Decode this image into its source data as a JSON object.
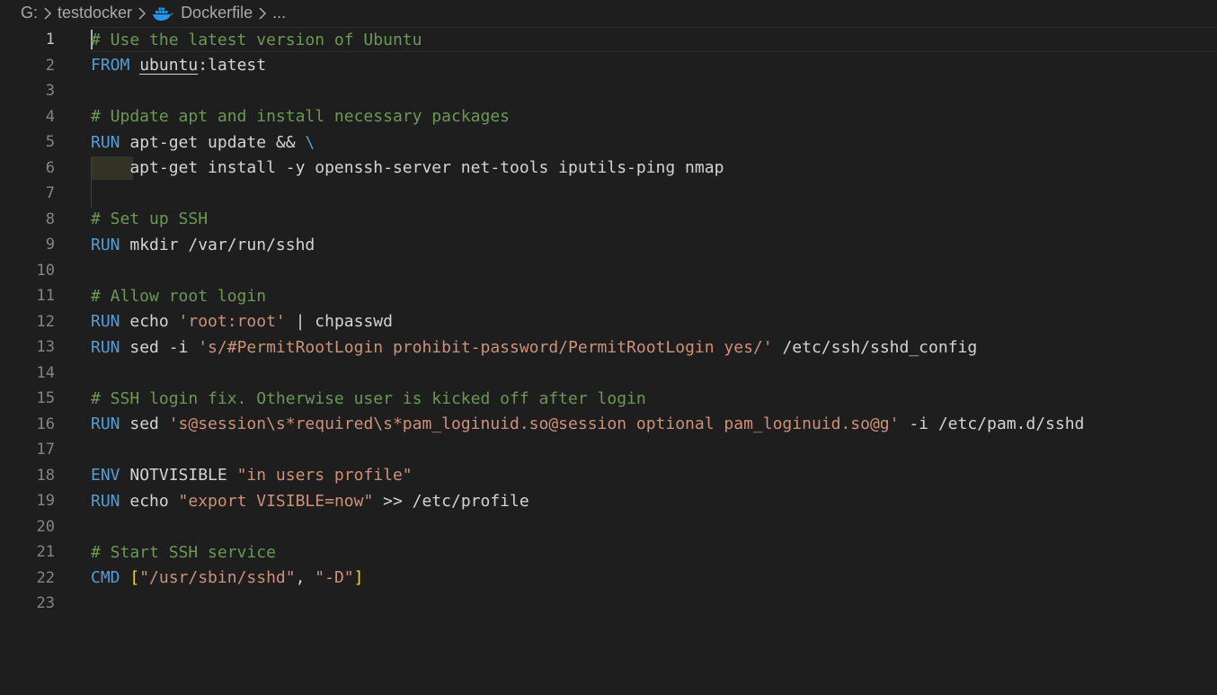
{
  "breadcrumb": {
    "items": [
      {
        "label": "G:",
        "icon": ""
      },
      {
        "label": "testdocker",
        "icon": ""
      },
      {
        "label": "Dockerfile",
        "icon": "docker-whale-icon"
      },
      {
        "label": "...",
        "icon": ""
      }
    ],
    "separator_icon": "chevron-right-icon"
  },
  "colors": {
    "background": "#1e1e1e",
    "comment": "#6a9955",
    "keyword": "#569cd6",
    "string": "#ce9178",
    "text": "#d4d4d4",
    "bracket": "#ffd700",
    "line_number": "#858585",
    "docker": "#2496ed"
  },
  "editor": {
    "active_line": 1,
    "lines": [
      {
        "n": "1",
        "tokens": [
          [
            "c-comment",
            "# Use the latest version of Ubuntu"
          ]
        ]
      },
      {
        "n": "2",
        "tokens": [
          [
            "c-kw",
            "FROM"
          ],
          [
            "c-plain",
            " "
          ],
          [
            "c-plain c-link",
            "ubuntu"
          ],
          [
            "c-plain",
            ":latest"
          ]
        ]
      },
      {
        "n": "3",
        "tokens": []
      },
      {
        "n": "4",
        "tokens": [
          [
            "c-comment",
            "# Update apt and install necessary packages"
          ]
        ]
      },
      {
        "n": "5",
        "tokens": [
          [
            "c-kw",
            "RUN"
          ],
          [
            "c-plain",
            " apt-get update && "
          ],
          [
            "c-kw",
            "\\"
          ]
        ]
      },
      {
        "n": "6",
        "tokens": [
          [
            "c-plain",
            "    apt-get install -y openssh-server net-tools iputils-ping nmap"
          ]
        ]
      },
      {
        "n": "7",
        "tokens": []
      },
      {
        "n": "8",
        "tokens": [
          [
            "c-comment",
            "# Set up SSH"
          ]
        ]
      },
      {
        "n": "9",
        "tokens": [
          [
            "c-kw",
            "RUN"
          ],
          [
            "c-plain",
            " mkdir /var/run/sshd"
          ]
        ]
      },
      {
        "n": "10",
        "tokens": []
      },
      {
        "n": "11",
        "tokens": [
          [
            "c-comment",
            "# Allow root login"
          ]
        ]
      },
      {
        "n": "12",
        "tokens": [
          [
            "c-kw",
            "RUN"
          ],
          [
            "c-plain",
            " echo "
          ],
          [
            "c-str",
            "'root:root'"
          ],
          [
            "c-plain",
            " | chpasswd"
          ]
        ]
      },
      {
        "n": "13",
        "tokens": [
          [
            "c-kw",
            "RUN"
          ],
          [
            "c-plain",
            " sed -i "
          ],
          [
            "c-str",
            "'s/#PermitRootLogin prohibit-password/PermitRootLogin yes/'"
          ],
          [
            "c-plain",
            " /etc/ssh/sshd_config"
          ]
        ]
      },
      {
        "n": "14",
        "tokens": []
      },
      {
        "n": "15",
        "tokens": [
          [
            "c-comment",
            "# SSH login fix. Otherwise user is kicked off after login"
          ]
        ]
      },
      {
        "n": "16",
        "tokens": [
          [
            "c-kw",
            "RUN"
          ],
          [
            "c-plain",
            " sed "
          ],
          [
            "c-str",
            "'s@session\\s*required\\s*pam_loginuid.so@session optional pam_loginuid.so@g'"
          ],
          [
            "c-plain",
            " -i /etc/pam.d/sshd"
          ]
        ]
      },
      {
        "n": "17",
        "tokens": []
      },
      {
        "n": "18",
        "tokens": [
          [
            "c-kw",
            "ENV"
          ],
          [
            "c-plain",
            " NOTVISIBLE "
          ],
          [
            "c-str",
            "\"in users profile\""
          ]
        ]
      },
      {
        "n": "19",
        "tokens": [
          [
            "c-kw",
            "RUN"
          ],
          [
            "c-plain",
            " echo "
          ],
          [
            "c-str",
            "\"export VISIBLE=now\""
          ],
          [
            "c-plain",
            " >> /etc/profile"
          ]
        ]
      },
      {
        "n": "20",
        "tokens": []
      },
      {
        "n": "21",
        "tokens": [
          [
            "c-comment",
            "# Start SSH service"
          ]
        ]
      },
      {
        "n": "22",
        "tokens": [
          [
            "c-kw",
            "CMD"
          ],
          [
            "c-plain",
            " "
          ],
          [
            "c-bracket",
            "["
          ],
          [
            "c-str",
            "\"/usr/sbin/sshd\""
          ],
          [
            "c-plain",
            ", "
          ],
          [
            "c-str",
            "\"-D\""
          ],
          [
            "c-bracket",
            "]"
          ]
        ]
      },
      {
        "n": "23",
        "tokens": []
      }
    ]
  }
}
